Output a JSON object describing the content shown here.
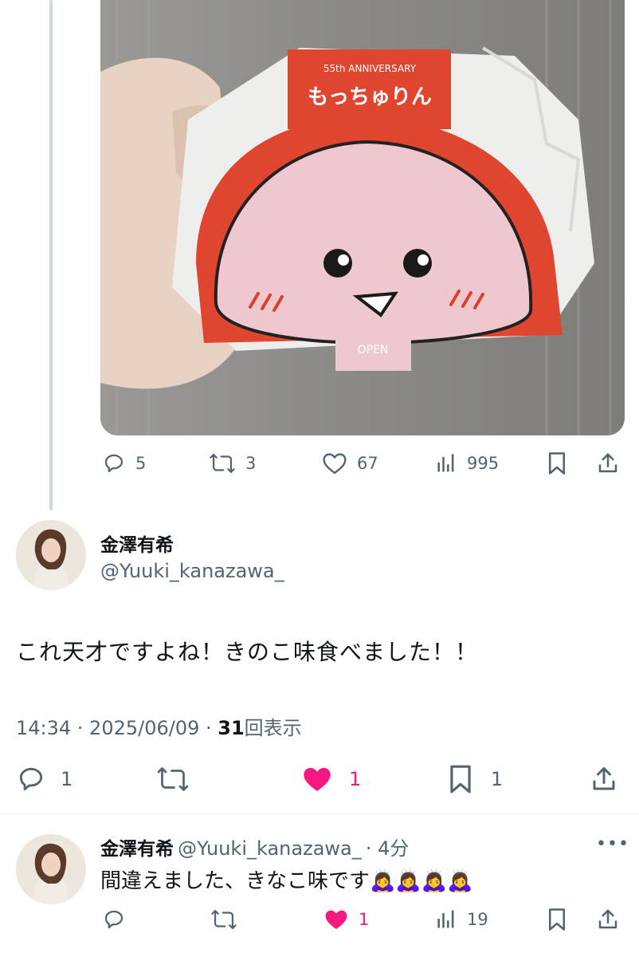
{
  "first_tweet": {
    "photo": {
      "package_badge": "55th ANNIVERSARY",
      "package_label": "もっちゅりん",
      "tab_label": "OPEN"
    },
    "actions": {
      "replies": "5",
      "retweets": "3",
      "likes": "67",
      "views": "995"
    }
  },
  "main_tweet": {
    "author_name": "金澤有希",
    "author_handle": "@Yuuki_kanazawa_",
    "text": "これ天才ですよね！きのこ味食べました！！",
    "time": "14:34 · 2025/06/09 · ",
    "views_count": "31",
    "views_label": "回表示",
    "actions": {
      "replies": "1",
      "likes": "1",
      "bookmarks": "1"
    },
    "like_color": "#f91880"
  },
  "reply_tweet": {
    "author_name": "金澤有希",
    "author_handle": "@Yuuki_kanazawa_",
    "time_ago": "· 4分",
    "text": "間違えました、きなこ味です",
    "emoji": "🙇‍♀️🙇‍♀️🙇‍♀️🙇‍♀️",
    "actions": {
      "likes": "1",
      "views": "19"
    }
  },
  "colors": {
    "muted": "#536471",
    "like": "#f91880",
    "thread_line": "#cfd9de"
  }
}
